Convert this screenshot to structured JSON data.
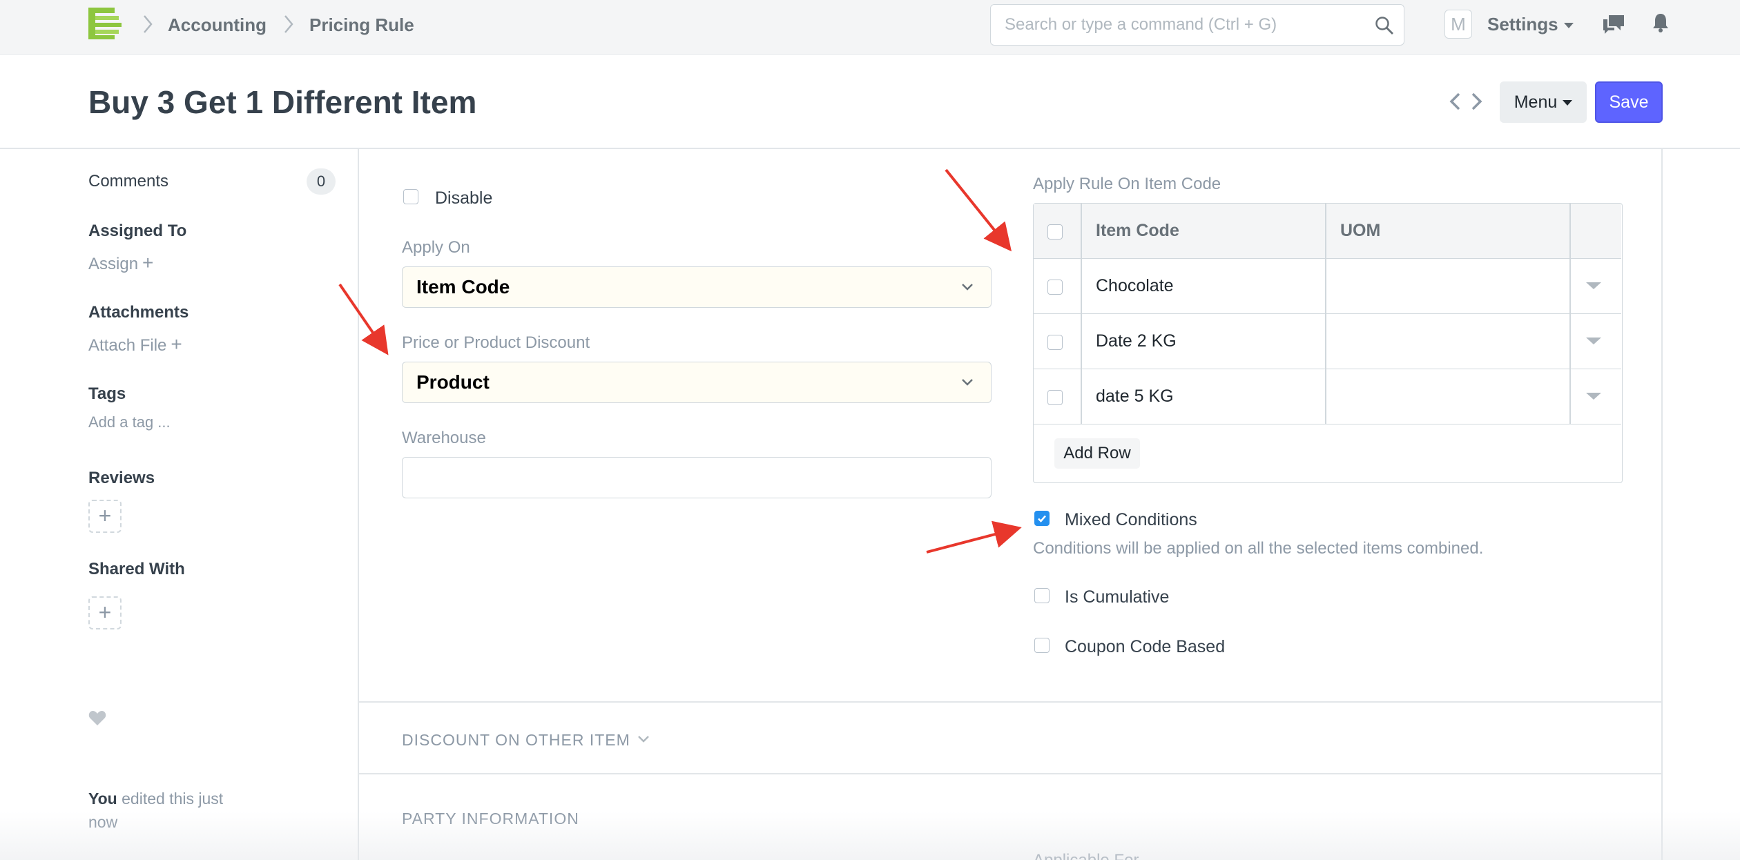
{
  "navbar": {
    "breadcrumbs": [
      "Accounting",
      "Pricing Rule"
    ],
    "search_placeholder": "Search or type a command (Ctrl + G)",
    "avatar_initial": "M",
    "settings_label": "Settings"
  },
  "page": {
    "title": "Buy 3 Get 1 Different Item",
    "menu_label": "Menu",
    "save_label": "Save"
  },
  "sidebar": {
    "comments_label": "Comments",
    "comments_count": "0",
    "assigned_to_label": "Assigned To",
    "assign_link": "Assign",
    "attachments_label": "Attachments",
    "attach_link": "Attach File",
    "tags_label": "Tags",
    "add_tag_link": "Add a tag ...",
    "reviews_label": "Reviews",
    "shared_with_label": "Shared With",
    "activity_user": "You",
    "activity_text": " edited this just now",
    "plus_glyph": "+"
  },
  "form": {
    "disable_label": "Disable",
    "disable_checked": false,
    "apply_on_label": "Apply On",
    "apply_on_value": "Item Code",
    "price_or_product_label": "Price or Product Discount",
    "price_or_product_value": "Product",
    "warehouse_label": "Warehouse",
    "warehouse_value": "",
    "apply_rule_label": "Apply Rule On Item Code",
    "grid": {
      "columns": [
        "Item Code",
        "UOM"
      ],
      "rows": [
        {
          "item_code": "Chocolate",
          "uom": ""
        },
        {
          "item_code": "Date 2 KG",
          "uom": ""
        },
        {
          "item_code": "date 5 KG",
          "uom": ""
        }
      ],
      "add_row_label": "Add Row"
    },
    "mixed_conditions_label": "Mixed Conditions",
    "mixed_conditions_checked": true,
    "mixed_conditions_desc": "Conditions will be applied on all the selected items combined.",
    "is_cumulative_label": "Is Cumulative",
    "is_cumulative_checked": false,
    "coupon_code_label": "Coupon Code Based",
    "coupon_code_checked": false
  },
  "sections": {
    "discount_other_item": "DISCOUNT ON OTHER ITEM",
    "party_information": "PARTY INFORMATION",
    "applicable_for_partial": "Applicable For"
  },
  "colors": {
    "primary": "#5e64ff",
    "checkbox_checked": "#2490ef",
    "annotation_arrow": "#e8372c",
    "logo_green": "#8dc63f"
  }
}
